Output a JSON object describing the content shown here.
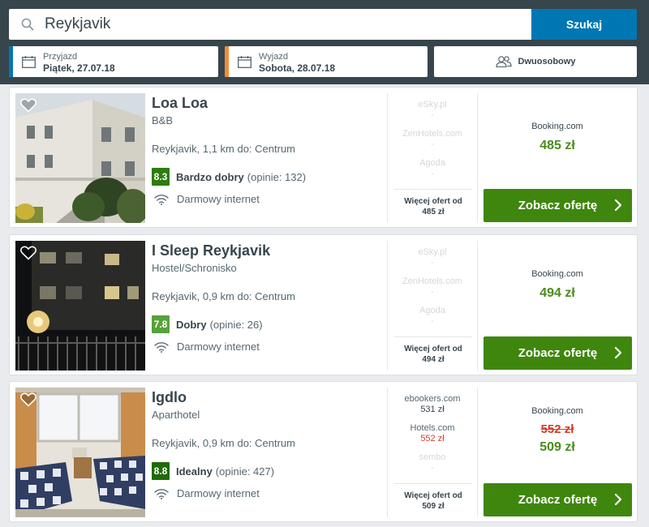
{
  "search": {
    "query": "Reykjavik",
    "button_label": "Szukaj"
  },
  "checkin": {
    "label": "Przyjazd",
    "value": "Piątek, 27.07.18",
    "accent": "#0077b3"
  },
  "checkout": {
    "label": "Wyjazd",
    "value": "Sobota, 28.07.18",
    "accent": "#f28d33"
  },
  "room": {
    "value": "Dwuosobowy"
  },
  "results": [
    {
      "name": "Loa Loa",
      "type": "B&B",
      "location": "Reykjavik, 1,1 km do: Centrum",
      "score": "8.3",
      "score_color": "#2e7d0c",
      "rating_text": "Bardzo dobry",
      "reviews": "(opinie: 132)",
      "amenity": "Darmowy internet",
      "offers": [
        {
          "name": "eSky.pl",
          "price": "-",
          "style": "dim"
        },
        {
          "name": "ZenHotels.com",
          "price": "-",
          "style": "dim"
        },
        {
          "name": "Agoda",
          "price": "-",
          "style": "dim"
        }
      ],
      "more_label": "Więcej ofert od",
      "more_price": "485 zł",
      "partner": "Booking.com",
      "old_price": "",
      "price": "485 zł",
      "button_label": "Zobacz ofertę"
    },
    {
      "name": "I Sleep Reykjavik",
      "type": "Hostel/Schronisko",
      "location": "Reykjavik, 0,9 km do: Centrum",
      "score": "7.8",
      "score_color": "#57a23a",
      "rating_text": "Dobry",
      "reviews": "(opinie: 26)",
      "amenity": "Darmowy internet",
      "offers": [
        {
          "name": "eSky.pl",
          "price": "-",
          "style": "dim"
        },
        {
          "name": "ZenHotels.com",
          "price": "-",
          "style": "dim"
        },
        {
          "name": "Agoda",
          "price": "-",
          "style": "dim"
        }
      ],
      "more_label": "Więcej ofert od",
      "more_price": "494 zł",
      "partner": "Booking.com",
      "old_price": "",
      "price": "494 zł",
      "button_label": "Zobacz ofertę"
    },
    {
      "name": "Igdlo",
      "type": "Aparthotel",
      "location": "Reykjavik, 0,9 km do: Centrum",
      "score": "8.8",
      "score_color": "#1f6b08",
      "rating_text": "Idealny",
      "reviews": "(opinie: 427)",
      "amenity": "Darmowy internet",
      "offers": [
        {
          "name": "ebookers.com",
          "price": "531 zł",
          "style": "live"
        },
        {
          "name": "Hotels.com",
          "price": "552 zł",
          "style": "live",
          "red": true
        },
        {
          "name": "sembo",
          "price": "-",
          "style": "dim"
        }
      ],
      "more_label": "Więcej ofert od",
      "more_price": "509 zł",
      "partner": "Booking.com",
      "old_price": "552 zł",
      "price": "509 zł",
      "button_label": "Zobacz ofertę"
    }
  ]
}
